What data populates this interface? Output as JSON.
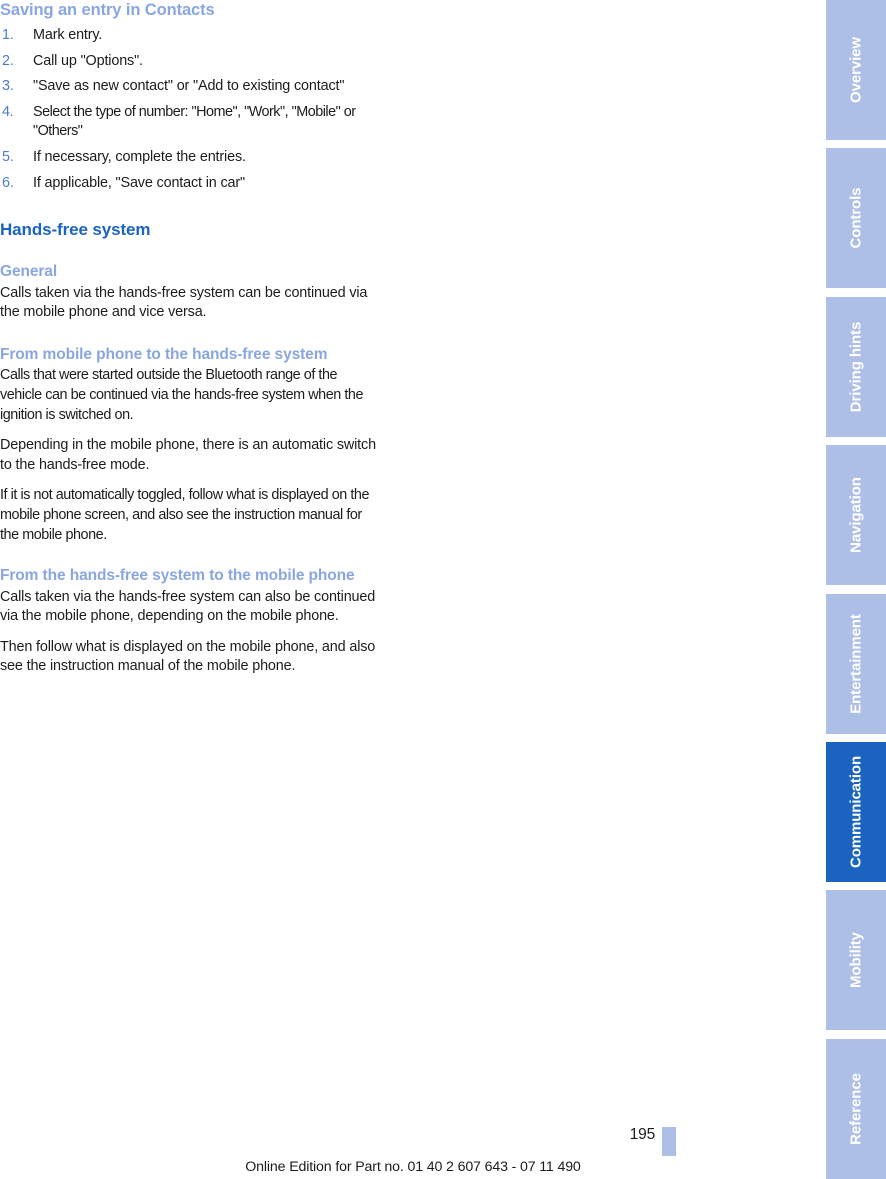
{
  "document": {
    "section_heading": "Saving an entry in Contacts",
    "chapter_heading": "Hands-free system"
  },
  "steps": [
    {
      "num": "1.",
      "text": "Mark entry."
    },
    {
      "num": "2.",
      "text": "Call up \"Options\"."
    },
    {
      "num": "3.",
      "text": "\"Save as new contact\" or \"Add to existing contact\""
    },
    {
      "num": "4.",
      "text": "Select the type of number: \"Home\", \"Work\", \"Mobile\" or \"Others\""
    },
    {
      "num": "5.",
      "text": "If necessary, complete the entries."
    },
    {
      "num": "6.",
      "text": "If applicable, \"Save contact in car\""
    }
  ],
  "subsections": {
    "general": {
      "heading": "General",
      "p1": "Calls taken via the hands-free system can be continued via the mobile phone and vice versa."
    },
    "from_mobile": {
      "heading": "From mobile phone to the hands-free system",
      "p1": "Calls that were started outside the Bluetooth range of the vehicle can be continued via the hands-free system when the ignition is switched on.",
      "p2": "Depending in the mobile phone, there is an automatic switch to the hands-free mode.",
      "p3": "If it is not automatically toggled, follow what is displayed on the mobile phone screen, and also see the instruction manual for the mobile phone."
    },
    "from_handsfree": {
      "heading": "From the hands-free system to the mobile phone",
      "p1": "Calls taken via the hands-free system can also be continued via the mobile phone, depending on the mobile phone.",
      "p2": "Then follow what is displayed on the mobile phone, and also see the instruction manual of the mobile phone."
    }
  },
  "footer": {
    "page_number": "195",
    "online_edition": "Online Edition for Part no. 01 40 2 607 643 - 07 11 490"
  },
  "tab_rail": {
    "tabs": [
      {
        "label": "Overview",
        "active": false
      },
      {
        "label": "Controls",
        "active": false
      },
      {
        "label": "Driving hints",
        "active": false
      },
      {
        "label": "Navigation",
        "active": false
      },
      {
        "label": "Entertainment",
        "active": false
      },
      {
        "label": "Communication",
        "active": true
      },
      {
        "label": "Mobility",
        "active": false
      },
      {
        "label": "Reference",
        "active": false
      }
    ]
  },
  "colors": {
    "heading_light_blue": "#8aa6e0",
    "heading_dark_blue": "#1a64c0",
    "list_number_blue": "#4a7fc8",
    "tab_inactive": "#adbfe6",
    "tab_active": "#1a64c0",
    "body_text": "#1c1c1c"
  }
}
